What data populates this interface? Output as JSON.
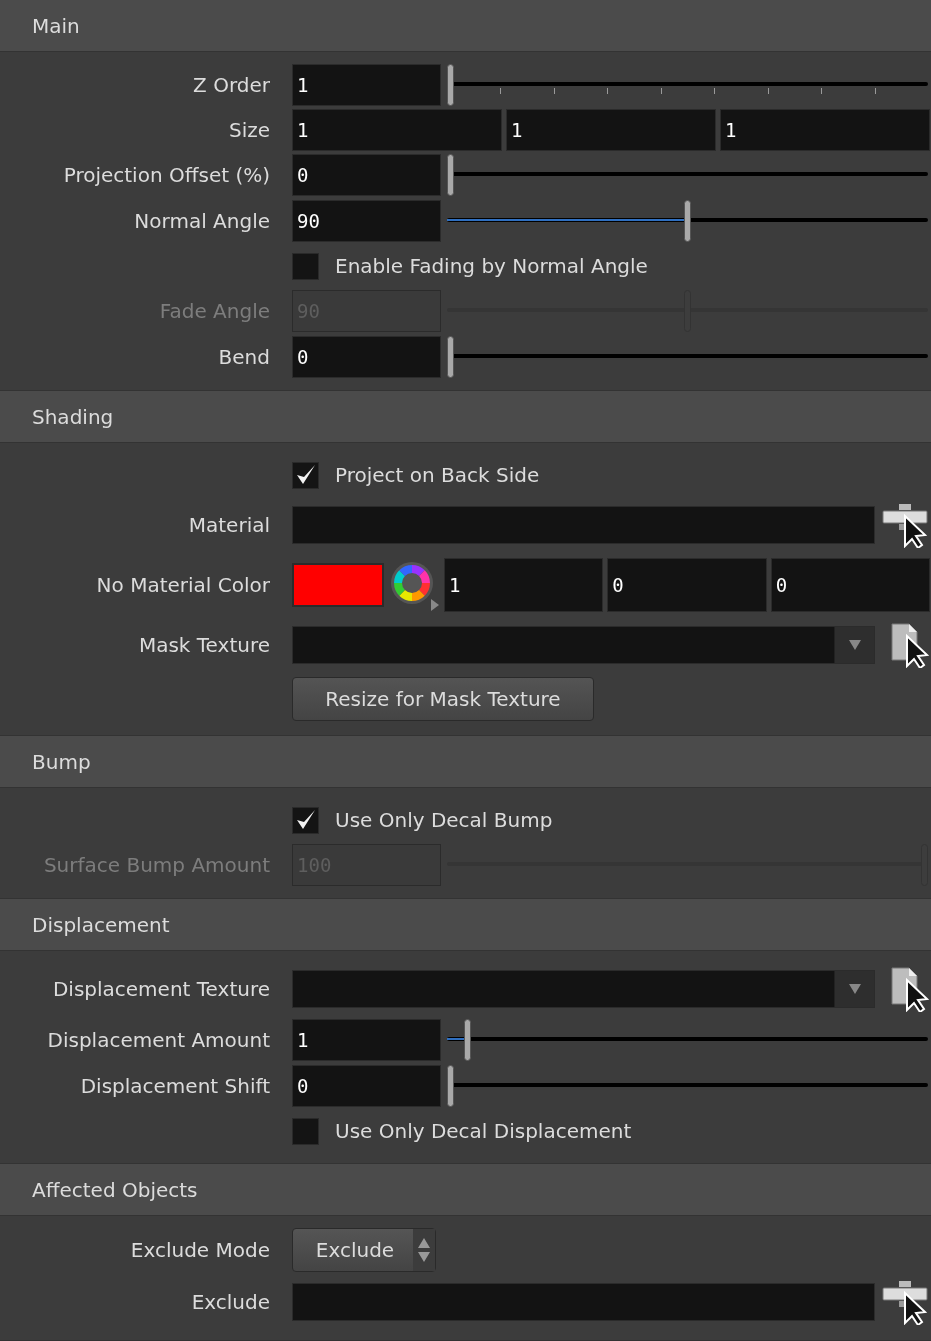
{
  "sections": [
    {
      "title": "Main",
      "rows": [
        {
          "kind": "slider",
          "label": "Z Order",
          "value": "1",
          "level": 0,
          "ticks": true,
          "disabled": false
        },
        {
          "kind": "vector",
          "label": "Size",
          "values": [
            "1",
            "1",
            "1"
          ]
        },
        {
          "kind": "slider",
          "label": "Projection Offset (%)",
          "value": "0",
          "level": 0,
          "ticks": false,
          "disabled": false
        },
        {
          "kind": "slider",
          "label": "Normal Angle",
          "value": "90",
          "level": 0.5,
          "ticks": false,
          "disabled": false
        },
        {
          "kind": "checkbox",
          "text": "Enable Fading by Normal Angle",
          "checked": false
        },
        {
          "kind": "slider",
          "label": "Fade Angle",
          "value": "90",
          "level": 0.5,
          "ticks": false,
          "disabled": true
        },
        {
          "kind": "slider",
          "label": "Bend",
          "value": "0",
          "level": 0,
          "ticks": false,
          "disabled": false
        }
      ]
    },
    {
      "title": "Shading",
      "rows": [
        {
          "kind": "checkbox",
          "text": "Project on Back Side",
          "checked": true
        },
        {
          "kind": "picker",
          "label": "Material"
        },
        {
          "kind": "color",
          "label": "No Material Color",
          "color": "#ff0000",
          "values": [
            "1",
            "0",
            "0"
          ]
        },
        {
          "kind": "file",
          "label": "Mask Texture"
        },
        {
          "kind": "button",
          "text": "Resize for Mask Texture"
        }
      ]
    },
    {
      "title": "Bump",
      "rows": [
        {
          "kind": "checkbox",
          "text": "Use Only Decal Bump",
          "checked": true
        },
        {
          "kind": "slider",
          "label": "Surface Bump Amount",
          "value": "100",
          "level": 1,
          "ticks": false,
          "disabled": true
        }
      ]
    },
    {
      "title": "Displacement",
      "rows": [
        {
          "kind": "file",
          "label": "Displacement Texture"
        },
        {
          "kind": "slider",
          "label": "Displacement Amount",
          "value": "1",
          "level": 0.035,
          "ticks": false,
          "disabled": false
        },
        {
          "kind": "slider",
          "label": "Displacement Shift",
          "value": "0",
          "level": 0,
          "ticks": false,
          "disabled": false
        },
        {
          "kind": "checkbox",
          "text": "Use Only Decal Displacement",
          "checked": false
        }
      ]
    },
    {
      "title": "Affected Objects",
      "rows": [
        {
          "kind": "menu",
          "label": "Exclude Mode",
          "value": "Exclude"
        },
        {
          "kind": "picker",
          "label": "Exclude"
        }
      ]
    }
  ]
}
